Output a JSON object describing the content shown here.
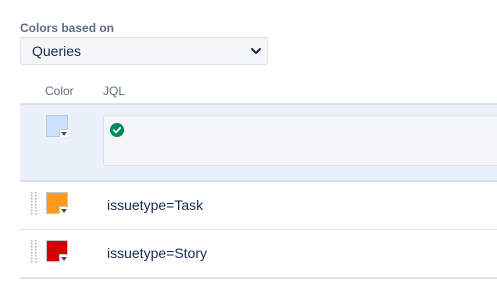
{
  "form": {
    "section_label": "Colors based on",
    "select_value": "Queries"
  },
  "table": {
    "headers": {
      "color": "Color",
      "jql": "JQL"
    },
    "editing_row": {
      "swatch_color": "#cce0ff",
      "query": ""
    },
    "rows": [
      {
        "query": "issuetype=Task",
        "swatch_color": "#ff991f"
      },
      {
        "query": "issuetype=Story",
        "swatch_color": "#d00000"
      }
    ]
  },
  "colors": {
    "accent_valid": "#00875a",
    "editing_background": "#eaf1fb"
  },
  "icons": {
    "select": "chevron-down-icon",
    "valid": "check-circle-icon",
    "handle": "drag-handle-icon",
    "swatch_arrow": "triangle-down-icon"
  }
}
